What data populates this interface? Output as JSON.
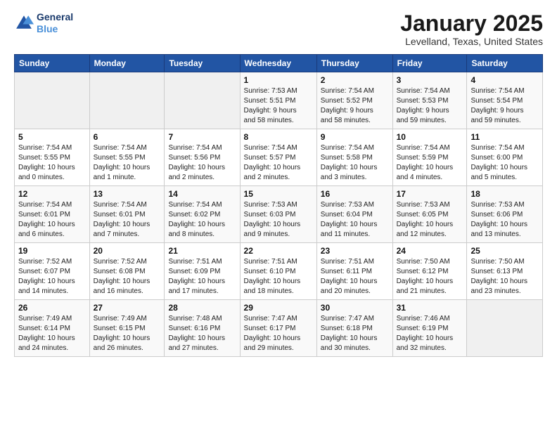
{
  "logo": {
    "line1": "General",
    "line2": "Blue"
  },
  "header": {
    "title": "January 2025",
    "location": "Levelland, Texas, United States"
  },
  "weekdays": [
    "Sunday",
    "Monday",
    "Tuesday",
    "Wednesday",
    "Thursday",
    "Friday",
    "Saturday"
  ],
  "weeks": [
    [
      {
        "day": "",
        "info": ""
      },
      {
        "day": "",
        "info": ""
      },
      {
        "day": "",
        "info": ""
      },
      {
        "day": "1",
        "info": "Sunrise: 7:53 AM\nSunset: 5:51 PM\nDaylight: 9 hours\nand 58 minutes."
      },
      {
        "day": "2",
        "info": "Sunrise: 7:54 AM\nSunset: 5:52 PM\nDaylight: 9 hours\nand 58 minutes."
      },
      {
        "day": "3",
        "info": "Sunrise: 7:54 AM\nSunset: 5:53 PM\nDaylight: 9 hours\nand 59 minutes."
      },
      {
        "day": "4",
        "info": "Sunrise: 7:54 AM\nSunset: 5:54 PM\nDaylight: 9 hours\nand 59 minutes."
      }
    ],
    [
      {
        "day": "5",
        "info": "Sunrise: 7:54 AM\nSunset: 5:55 PM\nDaylight: 10 hours\nand 0 minutes."
      },
      {
        "day": "6",
        "info": "Sunrise: 7:54 AM\nSunset: 5:55 PM\nDaylight: 10 hours\nand 1 minute."
      },
      {
        "day": "7",
        "info": "Sunrise: 7:54 AM\nSunset: 5:56 PM\nDaylight: 10 hours\nand 2 minutes."
      },
      {
        "day": "8",
        "info": "Sunrise: 7:54 AM\nSunset: 5:57 PM\nDaylight: 10 hours\nand 2 minutes."
      },
      {
        "day": "9",
        "info": "Sunrise: 7:54 AM\nSunset: 5:58 PM\nDaylight: 10 hours\nand 3 minutes."
      },
      {
        "day": "10",
        "info": "Sunrise: 7:54 AM\nSunset: 5:59 PM\nDaylight: 10 hours\nand 4 minutes."
      },
      {
        "day": "11",
        "info": "Sunrise: 7:54 AM\nSunset: 6:00 PM\nDaylight: 10 hours\nand 5 minutes."
      }
    ],
    [
      {
        "day": "12",
        "info": "Sunrise: 7:54 AM\nSunset: 6:01 PM\nDaylight: 10 hours\nand 6 minutes."
      },
      {
        "day": "13",
        "info": "Sunrise: 7:54 AM\nSunset: 6:01 PM\nDaylight: 10 hours\nand 7 minutes."
      },
      {
        "day": "14",
        "info": "Sunrise: 7:54 AM\nSunset: 6:02 PM\nDaylight: 10 hours\nand 8 minutes."
      },
      {
        "day": "15",
        "info": "Sunrise: 7:53 AM\nSunset: 6:03 PM\nDaylight: 10 hours\nand 9 minutes."
      },
      {
        "day": "16",
        "info": "Sunrise: 7:53 AM\nSunset: 6:04 PM\nDaylight: 10 hours\nand 11 minutes."
      },
      {
        "day": "17",
        "info": "Sunrise: 7:53 AM\nSunset: 6:05 PM\nDaylight: 10 hours\nand 12 minutes."
      },
      {
        "day": "18",
        "info": "Sunrise: 7:53 AM\nSunset: 6:06 PM\nDaylight: 10 hours\nand 13 minutes."
      }
    ],
    [
      {
        "day": "19",
        "info": "Sunrise: 7:52 AM\nSunset: 6:07 PM\nDaylight: 10 hours\nand 14 minutes."
      },
      {
        "day": "20",
        "info": "Sunrise: 7:52 AM\nSunset: 6:08 PM\nDaylight: 10 hours\nand 16 minutes."
      },
      {
        "day": "21",
        "info": "Sunrise: 7:51 AM\nSunset: 6:09 PM\nDaylight: 10 hours\nand 17 minutes."
      },
      {
        "day": "22",
        "info": "Sunrise: 7:51 AM\nSunset: 6:10 PM\nDaylight: 10 hours\nand 18 minutes."
      },
      {
        "day": "23",
        "info": "Sunrise: 7:51 AM\nSunset: 6:11 PM\nDaylight: 10 hours\nand 20 minutes."
      },
      {
        "day": "24",
        "info": "Sunrise: 7:50 AM\nSunset: 6:12 PM\nDaylight: 10 hours\nand 21 minutes."
      },
      {
        "day": "25",
        "info": "Sunrise: 7:50 AM\nSunset: 6:13 PM\nDaylight: 10 hours\nand 23 minutes."
      }
    ],
    [
      {
        "day": "26",
        "info": "Sunrise: 7:49 AM\nSunset: 6:14 PM\nDaylight: 10 hours\nand 24 minutes."
      },
      {
        "day": "27",
        "info": "Sunrise: 7:49 AM\nSunset: 6:15 PM\nDaylight: 10 hours\nand 26 minutes."
      },
      {
        "day": "28",
        "info": "Sunrise: 7:48 AM\nSunset: 6:16 PM\nDaylight: 10 hours\nand 27 minutes."
      },
      {
        "day": "29",
        "info": "Sunrise: 7:47 AM\nSunset: 6:17 PM\nDaylight: 10 hours\nand 29 minutes."
      },
      {
        "day": "30",
        "info": "Sunrise: 7:47 AM\nSunset: 6:18 PM\nDaylight: 10 hours\nand 30 minutes."
      },
      {
        "day": "31",
        "info": "Sunrise: 7:46 AM\nSunset: 6:19 PM\nDaylight: 10 hours\nand 32 minutes."
      },
      {
        "day": "",
        "info": ""
      }
    ]
  ]
}
